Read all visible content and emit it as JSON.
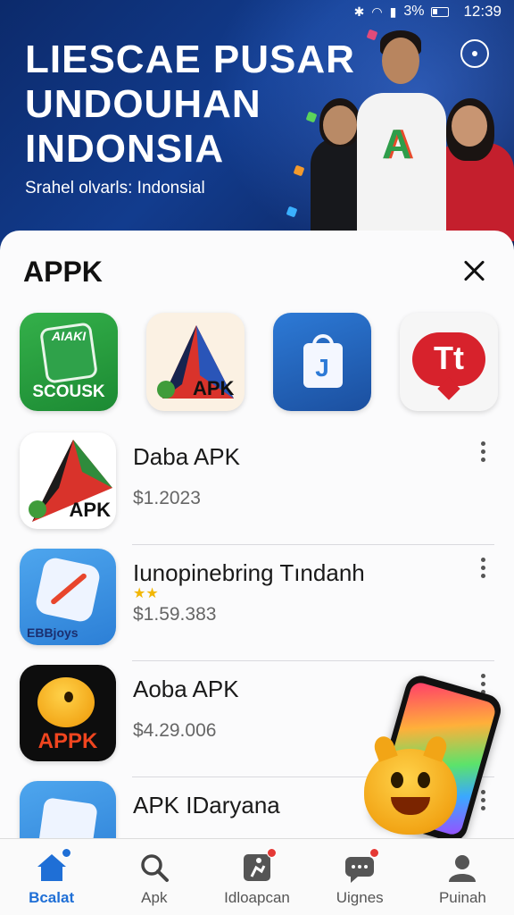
{
  "status_bar": {
    "battery_percent": "3%",
    "time": "12:39"
  },
  "hero": {
    "title_line1": "LIESCAE PUSAR",
    "title_line2": "UNDOUHAN",
    "title_line3": "INDONSIA",
    "subtitle": "Srahel olvarls: Indonsial",
    "person_logo": "A"
  },
  "sheet": {
    "title": "APPK"
  },
  "featured_apps": [
    {
      "top_text": "AIAKI",
      "bottom_text": "SCOUSK",
      "icon": "green-badge-icon"
    },
    {
      "label": "APK",
      "icon": "red-triangle-icon"
    },
    {
      "label": "J",
      "icon": "shopping-bag-icon"
    },
    {
      "label": "Tt",
      "icon": "red-speech-icon"
    }
  ],
  "app_list": [
    {
      "name": "Daba APK",
      "price": "$1.2023",
      "thumb_label": "APK"
    },
    {
      "name": "Iunopinebring Tındanh",
      "price": "$1.59.383",
      "thumb_label": "EBBjoys",
      "stars": "★★"
    },
    {
      "name": "Aoba APK",
      "price": "$4.29.006",
      "thumb_label": "APPK"
    },
    {
      "name": "APK IDaryana",
      "price": "$ . . . ."
    }
  ],
  "bottom_nav": [
    {
      "label": "Bcalat",
      "icon": "home-icon",
      "active": true
    },
    {
      "label": "Apk",
      "icon": "search-icon"
    },
    {
      "label": "Idloapcan",
      "icon": "runner-icon",
      "badge": true
    },
    {
      "label": "Uignes",
      "icon": "chat-icon",
      "badge": true
    },
    {
      "label": "Puinah",
      "icon": "person-icon"
    }
  ],
  "colors": {
    "hero_bg": "#123c8e",
    "accent": "#1f6fd6",
    "badge": "#e53935"
  }
}
